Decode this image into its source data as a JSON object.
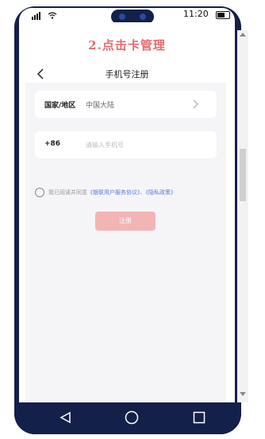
{
  "status_bar": {
    "signal": "signal-icon",
    "wifi": "wifi-icon",
    "time": "11:20",
    "battery": "battery-icon"
  },
  "banner": {
    "title": "2.点击卡管理"
  },
  "nav": {
    "back_icon": "chevron-left-icon",
    "title": "手机号注册"
  },
  "form": {
    "region": {
      "label": "国家/地区",
      "value": "中国大陆",
      "chevron": "chevron-right-icon"
    },
    "phone": {
      "prefix": "+86",
      "placeholder": "请输入手机号"
    },
    "agreement": {
      "prefix": "我已阅读并同意",
      "link1": "《银联用户服务协议》",
      "sep": "、",
      "link2": "《隐私政策》"
    },
    "register_button": "注册"
  },
  "system_nav": {
    "back": "triangle-back-icon",
    "home": "circle-home-icon",
    "recents": "square-recents-icon"
  }
}
